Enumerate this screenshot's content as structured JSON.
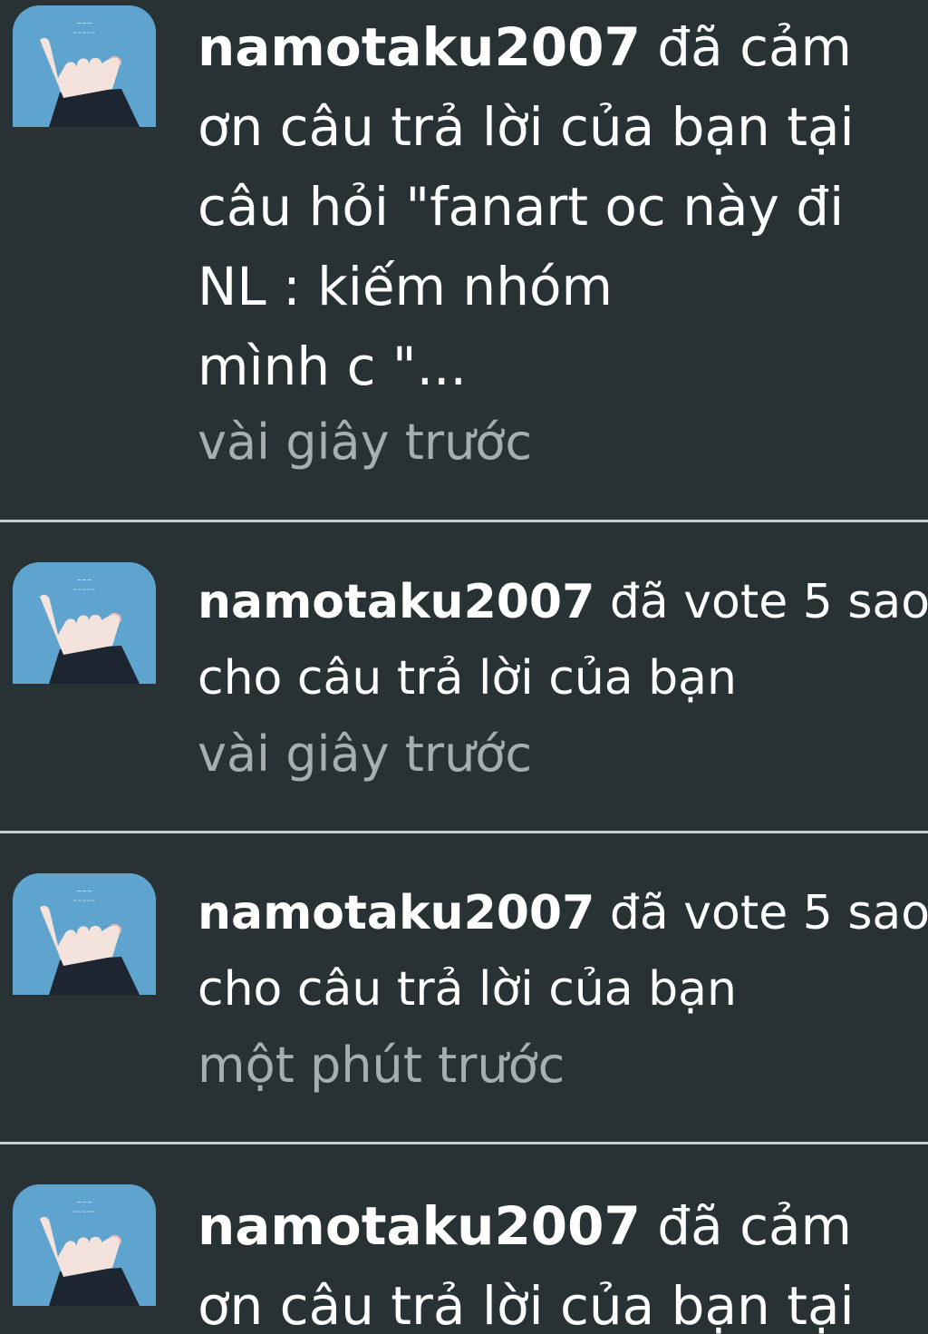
{
  "notifications": [
    {
      "username": "namotaku2007",
      "lines": [
        " đã cảm",
        "ơn câu trả lời của bạn tại",
        "câu hỏi \"fanart oc này đi",
        "NL : kiếm nhóm",
        "mình c \"..."
      ],
      "time": "vài giây trước",
      "avatar_icon": "hand-gesture-avatar-icon"
    },
    {
      "username": "namotaku2007",
      "lines": [
        "  đã vote 5 sao",
        "cho câu trả lời của bạn"
      ],
      "time": "vài giây trước",
      "avatar_icon": "hand-gesture-avatar-icon"
    },
    {
      "username": "namotaku2007",
      "lines": [
        "  đã vote 5 sao",
        "cho câu trả lời của bạn"
      ],
      "time": "một phút trước",
      "avatar_icon": "hand-gesture-avatar-icon"
    },
    {
      "username": "namotaku2007",
      "lines": [
        " đã cảm",
        "ơn câu trả lời của bạn tại"
      ],
      "time": "",
      "avatar_icon": "hand-gesture-avatar-icon"
    }
  ],
  "colors": {
    "background": "#283234",
    "text": "#ffffff",
    "time_text": "#a7aeb0",
    "divider": "#c9cfd1",
    "avatar_bg": "#5fa4cf"
  }
}
